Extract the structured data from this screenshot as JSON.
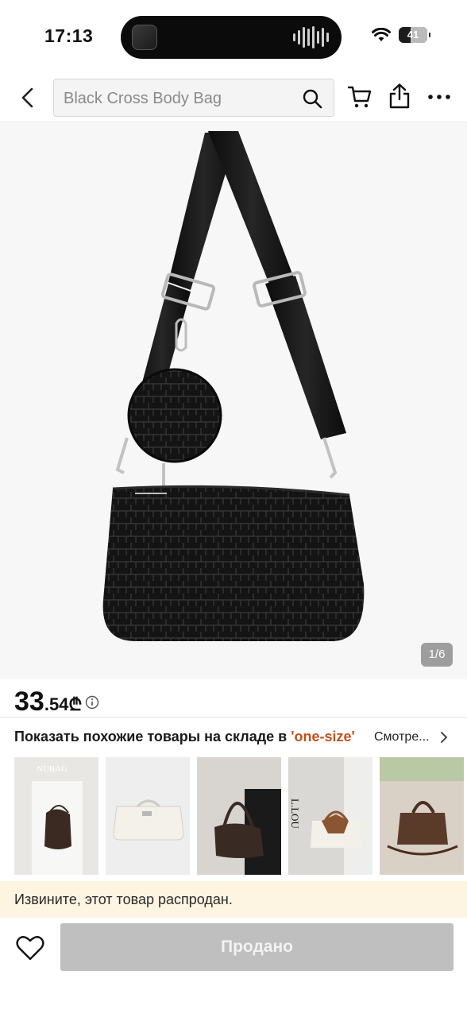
{
  "status_bar": {
    "time": "17:13",
    "battery_level": "41"
  },
  "header": {
    "search_placeholder": "Black Cross Body Bag"
  },
  "gallery": {
    "page_indicator": "1/6",
    "current_page": 1,
    "total_pages": 6
  },
  "price": {
    "integer": "33",
    "fraction": ".54",
    "currency": "₾"
  },
  "similar": {
    "title_prefix": "Показать похожие товары на складе в ",
    "title_size": "'one-size'",
    "more_label": "Смотре...",
    "thumbnail_labels": [
      "NUBAG",
      "L.LOU"
    ]
  },
  "notice": {
    "soldout_text": "Извините, этот товар распродан."
  },
  "bottom_bar": {
    "sold_button_label": "Продано"
  },
  "colors": {
    "accent": "#c4501c",
    "banner_bg": "#fdf4e2",
    "disabled_button": "#bfbfbf"
  }
}
